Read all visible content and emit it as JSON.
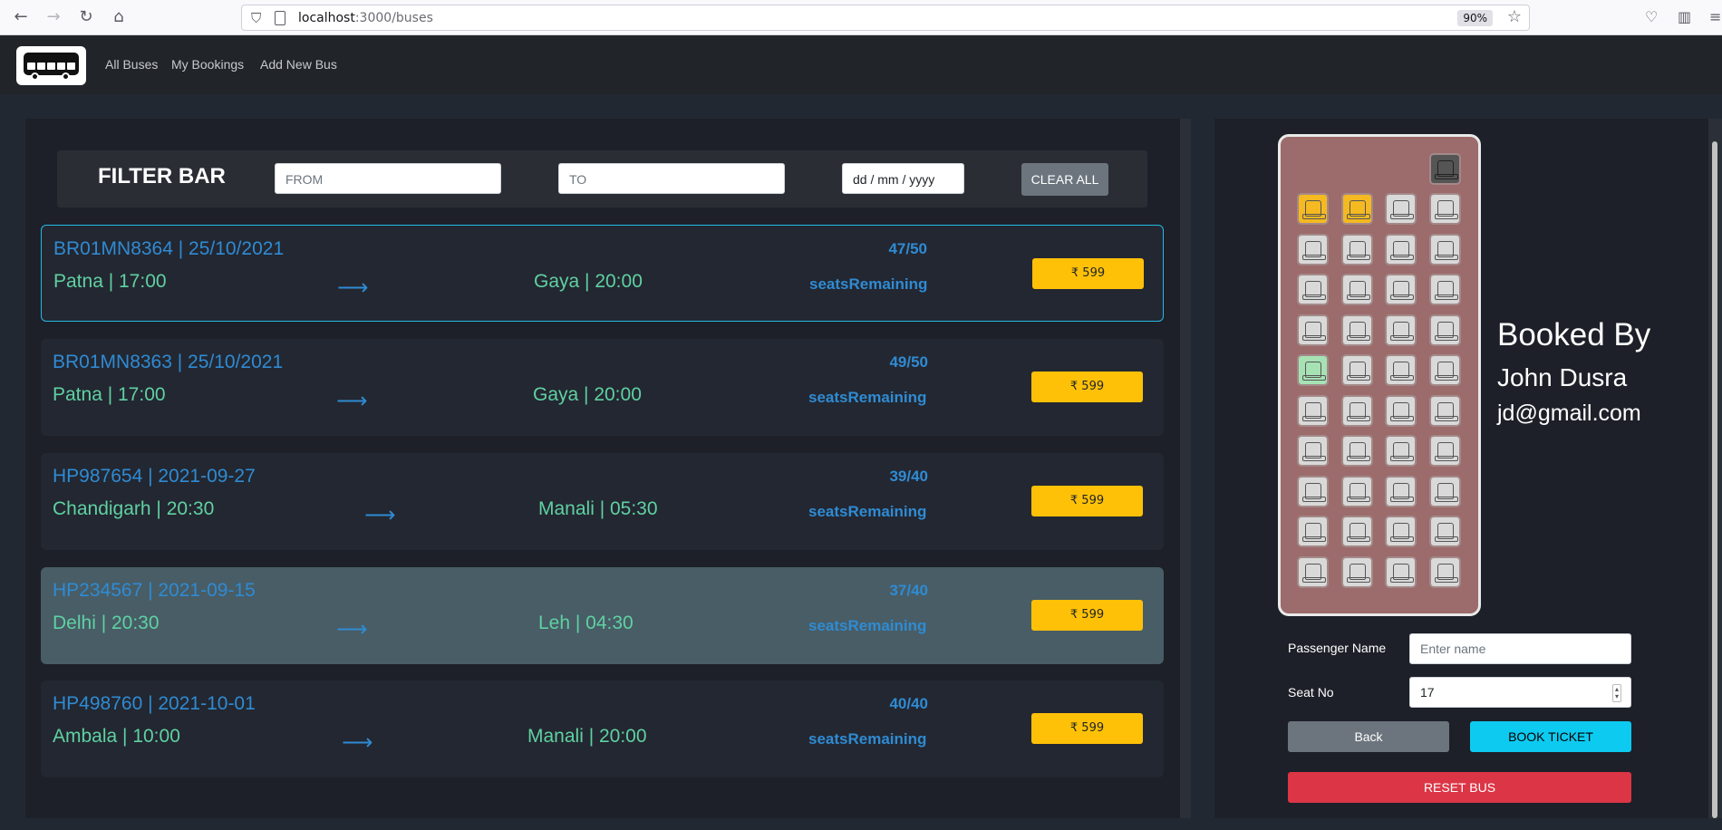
{
  "browser": {
    "url_host": "localhost",
    "url_path": ":3000/buses",
    "zoom": "90%"
  },
  "navbar": {
    "links": [
      "All Buses",
      "My Bookings",
      "Add New Bus"
    ]
  },
  "filter": {
    "title": "FILTER BAR",
    "from_placeholder": "FROM",
    "to_placeholder": "TO",
    "date_placeholder": "dd / mm / yyyy",
    "clear_label": "CLEAR ALL"
  },
  "buses": [
    {
      "id_date": "BR01MN8364 | 25/10/2021",
      "from": "Patna | 17:00",
      "to": "Gaya | 20:00",
      "seats": "47/50",
      "seats_label": "seatsRemaining",
      "price": "₹ 599",
      "state": "selected"
    },
    {
      "id_date": "BR01MN8363 | 25/10/2021",
      "from": "Patna | 17:00",
      "to": "Gaya | 20:00",
      "seats": "49/50",
      "seats_label": "seatsRemaining",
      "price": "₹ 599",
      "state": "normal"
    },
    {
      "id_date": "HP987654 | 2021-09-27",
      "from": "Chandigarh | 20:30",
      "to": "Manali | 05:30",
      "seats": "39/40",
      "seats_label": "seatsRemaining",
      "price": "₹ 599",
      "state": "normal"
    },
    {
      "id_date": "HP234567 | 2021-09-15",
      "from": "Delhi | 20:30",
      "to": "Leh | 04:30",
      "seats": "37/40",
      "seats_label": "seatsRemaining",
      "price": "₹ 599",
      "state": "hover"
    },
    {
      "id_date": "HP498760 | 2021-10-01",
      "from": "Ambala | 10:00",
      "to": "Manali | 20:00",
      "seats": "40/40",
      "seats_label": "seatsRemaining",
      "price": "₹ 599",
      "state": "normal"
    }
  ],
  "arrow_glyph": "⟶",
  "seat_layout": {
    "rows": 10,
    "cols": 4,
    "booked_seats": [
      1,
      2
    ],
    "selected_seat": 17,
    "colors": {
      "available": "#d9d9d9",
      "booked": "#f5b921",
      "selected": "#a7e2b5",
      "driver": "#555555"
    }
  },
  "booking_info": {
    "title": "Booked By",
    "name": "John Dusra",
    "email": "jd@gmail.com"
  },
  "form": {
    "passenger_label": "Passenger Name",
    "passenger_placeholder": "Enter name",
    "seat_label": "Seat No",
    "seat_value": "17",
    "back_label": "Back",
    "book_label": "BOOK TICKET",
    "reset_label": "RESET BUS"
  }
}
